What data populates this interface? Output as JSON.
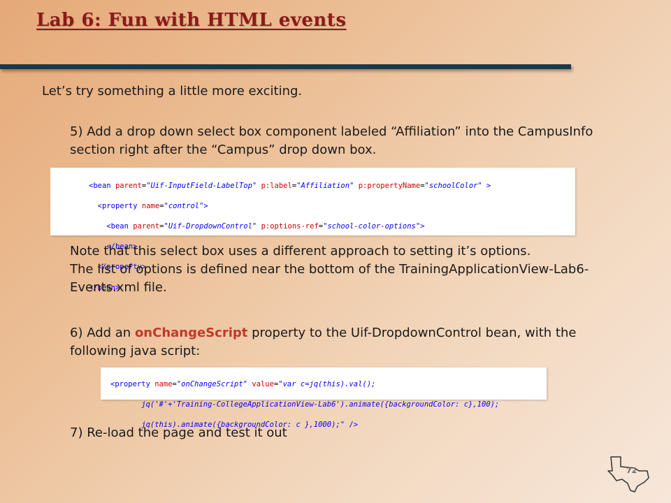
{
  "title": "Lab 6: Fun with HTML events",
  "intro": "Let’s try something a little more exciting.",
  "step5": "5) Add a drop down select box component labeled “Affiliation” into the CampusInfo section right after the “Campus” drop down box.",
  "code1": {
    "lines": [
      "<bean parent=\"Uif-InputField-LabelTop\" p:label=\"Affiliation\" p:propertyName=\"schoolColor\" >",
      "  <property name=\"control\">",
      "    <bean parent=\"Uif-DropdownControl\" p:options-ref=\"school-color-options\">",
      "    </bean>",
      "  </property>",
      "</bean>"
    ]
  },
  "note": {
    "line1": "Note that this select box uses a different approach to setting it’s options.",
    "line2": "The list of options is defined near the bottom of the TrainingApplicationView-Lab6-Events.xml file."
  },
  "step6": {
    "prefix": "6) Add an ",
    "highlight": "onChangeScript",
    "suffix": "  property to the Uif-DropdownControl bean, with the following java script:"
  },
  "code2": {
    "lines": [
      "<property name=\"onChangeScript\" value=\"var c=jq(this).val();",
      "       jq('#'+'Training-CollegeApplicationView-Lab6').animate({backgroundColor: c},100);",
      "       jq(this).animate({backgroundColor: c },1000);\" />"
    ]
  },
  "step7": "7) Re-load the page and test it out",
  "page_number": "72",
  "colors": {
    "title": "#8b1a1a",
    "rule": "#1a3a4a",
    "highlight": "#c0392b"
  }
}
